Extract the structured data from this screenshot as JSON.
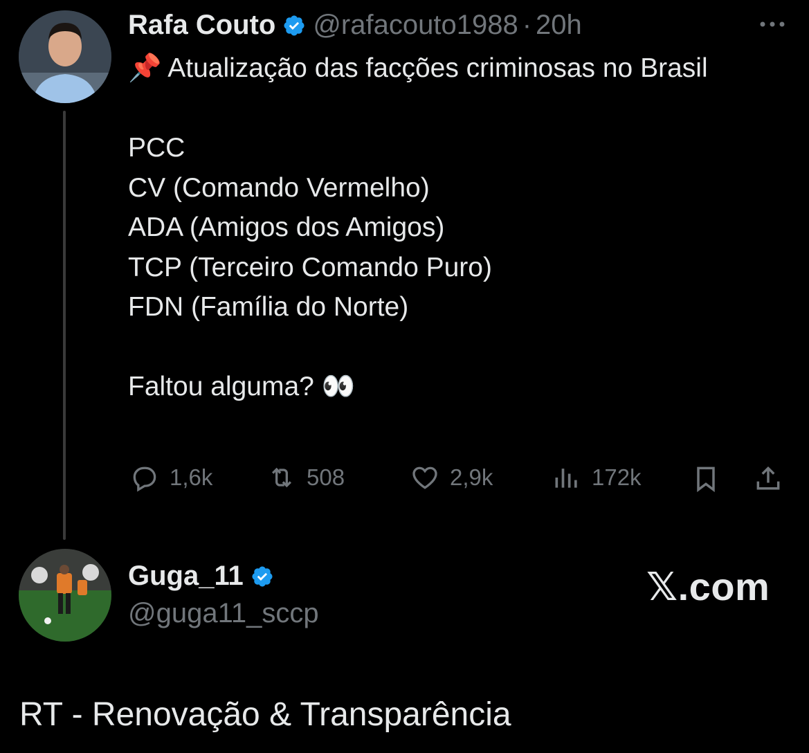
{
  "tweet": {
    "author_name": "Rafa Couto",
    "author_handle": "@rafacouto1988",
    "separator": "·",
    "time": "20h",
    "body": "📌 Atualização das facções criminosas no Brasil\n\nPCC\nCV (Comando Vermelho)\nADA (Amigos dos Amigos)\nTCP (Terceiro Comando Puro)\nFDN (Família do Norte)\n\nFaltou alguma? 👀",
    "actions": {
      "replies": "1,6k",
      "retweets": "508",
      "likes": "2,9k",
      "views": "172k"
    }
  },
  "quote_card": {
    "name": "Guga_11",
    "handle": "@guga11_sccp",
    "site": "𝕏.com"
  },
  "caption": "RT - Renovação & Transparência",
  "colors": {
    "background": "#000000",
    "text": "#e7e9ea",
    "muted": "#71767b",
    "verified": "#1d9bf0"
  },
  "icons": [
    "verified-badge-icon",
    "more-icon",
    "reply-icon",
    "retweet-icon",
    "like-icon",
    "views-icon",
    "bookmark-icon",
    "share-icon"
  ]
}
